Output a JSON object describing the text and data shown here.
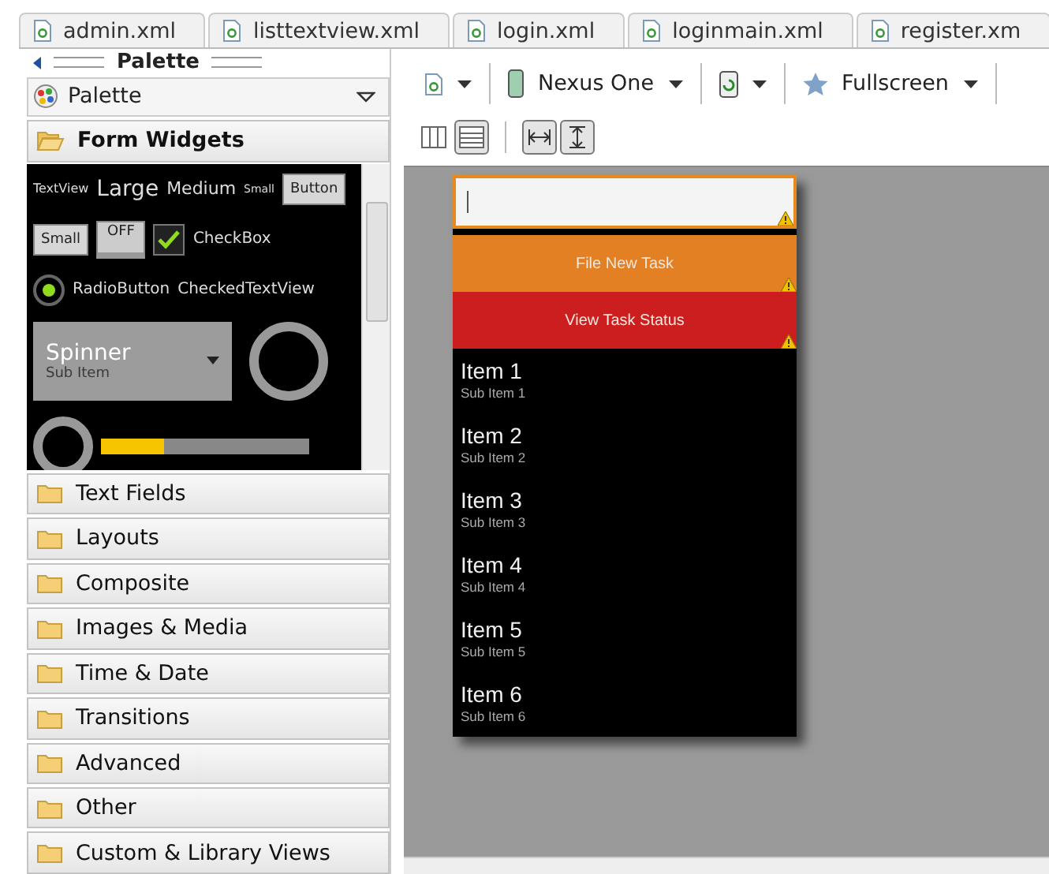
{
  "tabs": [
    {
      "label": "admin.xml"
    },
    {
      "label": "listtextview.xml"
    },
    {
      "label": "login.xml"
    },
    {
      "label": "loginmain.xml"
    },
    {
      "label": "register.xm"
    }
  ],
  "palette": {
    "title": "Palette",
    "dropdown": "Palette",
    "widgets": {
      "text_sizes": [
        "TextView",
        "Large",
        "Medium",
        "Small"
      ],
      "button": "Button",
      "small_button": "Small",
      "toggle": {
        "label": "OFF",
        "on": false
      },
      "checkbox": {
        "label": "CheckBox",
        "checked": true
      },
      "radio": {
        "label": "RadioButton",
        "checked": true
      },
      "checked_text_view": "CheckedTextView",
      "spinner": {
        "value": "Spinner",
        "sub": "Sub Item"
      },
      "progress": {
        "level": 0.3
      }
    },
    "categories": [
      {
        "label": "Form Widgets",
        "expanded": true
      },
      {
        "label": "Text Fields",
        "expanded": false
      },
      {
        "label": "Layouts",
        "expanded": false
      },
      {
        "label": "Composite",
        "expanded": false
      },
      {
        "label": "Images & Media",
        "expanded": false
      },
      {
        "label": "Time & Date",
        "expanded": false
      },
      {
        "label": "Transitions",
        "expanded": false
      },
      {
        "label": "Advanced",
        "expanded": false
      },
      {
        "label": "Other",
        "expanded": false
      },
      {
        "label": "Custom & Library Views",
        "expanded": false
      }
    ]
  },
  "toolbar": {
    "device": "Nexus One",
    "theme": "Fullscreen",
    "layout_modes": [
      {
        "selected": false
      },
      {
        "selected": true
      }
    ]
  },
  "screen": {
    "input": {
      "focused": true
    },
    "buttons": [
      {
        "label": "File New Task",
        "color": "#e38023"
      },
      {
        "label": "View Task Status",
        "color": "#cc1e1e"
      }
    ],
    "items": [
      {
        "title": "Item 1",
        "sub": "Sub Item 1"
      },
      {
        "title": "Item 2",
        "sub": "Sub Item 2"
      },
      {
        "title": "Item 3",
        "sub": "Sub Item 3"
      },
      {
        "title": "Item 4",
        "sub": "Sub Item 4"
      },
      {
        "title": "Item 5",
        "sub": "Sub Item 5"
      },
      {
        "title": "Item 6",
        "sub": "Sub Item 6"
      }
    ]
  }
}
